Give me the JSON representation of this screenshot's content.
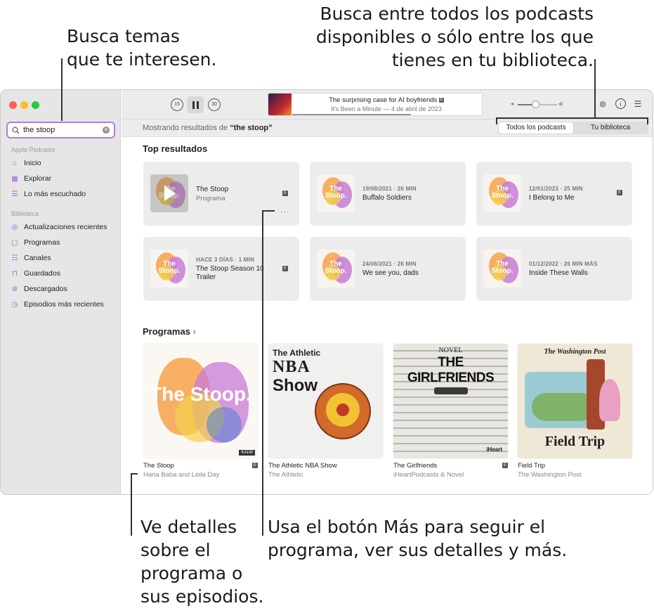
{
  "callouts": {
    "search_line1": "Busca temas",
    "search_line2": "que te interesen.",
    "scope_line1": "Busca entre todos los podcasts",
    "scope_line2": "disponibles o sólo entre los que",
    "scope_line3": "tienes en tu biblioteca.",
    "detail_line1": "Ve detalles",
    "detail_line2": "sobre el",
    "detail_line3": "programa o",
    "detail_line4": "sus episodios.",
    "more_line1": "Usa el botón Más para seguir el",
    "more_line2": "programa, ver sus detalles y más."
  },
  "sidebar": {
    "search_value": "the stoop",
    "section_apple": "Apple Podcasts",
    "apple_items": [
      {
        "label": "Inicio",
        "icon": "house-icon"
      },
      {
        "label": "Explorar",
        "icon": "grid-icon"
      },
      {
        "label": "Lo más escuchado",
        "icon": "list-icon"
      }
    ],
    "section_library": "Biblioteca",
    "library_items": [
      {
        "label": "Actualizaciones recientes",
        "icon": "checkmark-circle-icon"
      },
      {
        "label": "Programas",
        "icon": "shows-icon"
      },
      {
        "label": "Canales",
        "icon": "channels-icon"
      },
      {
        "label": "Guardados",
        "icon": "bookmark-icon"
      },
      {
        "label": "Descargados",
        "icon": "download-icon"
      },
      {
        "label": "Episodios más recientes",
        "icon": "clock-icon"
      }
    ]
  },
  "toolbar": {
    "skip_back": "15",
    "skip_forward": "30",
    "now_playing_title": "The surprising case for AI boyfriends",
    "explicit": "E",
    "now_playing_sub": "It's Been a Minute — 4 de abril de 2023",
    "progress": 0.62,
    "volume": 0.45
  },
  "results": {
    "prefix": "Mostrando resultados de ",
    "query": "“the stoop”",
    "scope_all": "Todos los podcasts",
    "scope_library": "Tu biblioteca"
  },
  "top_results": {
    "title": "Top resultados",
    "cards": [
      {
        "meta": "",
        "title": "The Stoop",
        "sub": "Programa",
        "art_text": "The Stoop."
      },
      {
        "meta": "19/08/2021 · 26 MIN",
        "title": "Buffalo Soldiers",
        "sub": "",
        "art_text": "The Stoop."
      },
      {
        "meta": "12/01/2023 · 25 MIN",
        "title": "I Belong to Me",
        "sub": "",
        "art_text": "The Stoop."
      },
      {
        "meta": "HACE 3 DÍAS · 1 MIN",
        "title": "The Stoop Season 10 Trailer",
        "sub": "",
        "art_text": "The Stoop."
      },
      {
        "meta": "24/06/2021 · 26 MIN",
        "title": "We see you, dads",
        "sub": "",
        "art_text": "The Stoop."
      },
      {
        "meta": "01/12/2022 · 26 MIN MÁS",
        "title": "Inside These Walls",
        "sub": "",
        "art_text": "The Stoop."
      }
    ],
    "more_button": "···"
  },
  "shows": {
    "title": "Programas",
    "chevron": "›",
    "items": [
      {
        "title": "The Stoop",
        "sub": "Hana Baba and Leila Day",
        "art_text": "The Stoop.",
        "art_badge": "KALW"
      },
      {
        "title": "The Athletic NBA Show",
        "sub": "The Athletic",
        "art_text": "The Athletic",
        "art_text2": "NBA",
        "art_text3": "Show"
      },
      {
        "title": "The Girlfriends",
        "sub": "iHeartPodcasts & Novel",
        "art_text": "NOVEL",
        "art_text2": "THE GIRLFRIENDS",
        "art_badge": "iHeart"
      },
      {
        "title": "Field Trip",
        "sub": "The Washington Post",
        "art_text": "The Washington Post",
        "art_text2": "Field Trip"
      }
    ]
  },
  "colors": {
    "accent": "#a05ad6",
    "search_border": "#b37be0",
    "sidebar_bg": "#e6e6e6",
    "card_bg": "#ececec"
  }
}
